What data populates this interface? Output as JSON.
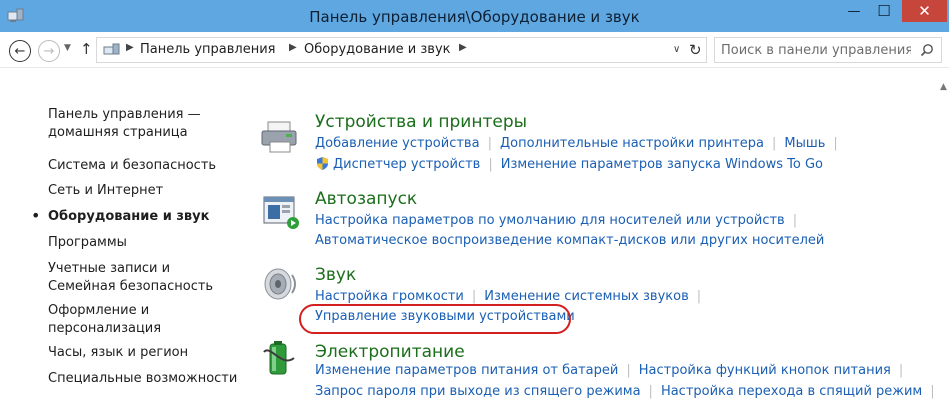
{
  "window": {
    "title": "Панель управления\\Оборудование и звук",
    "close_glyph": "✕",
    "minimize_glyph": "—",
    "maximize_glyph": "☐"
  },
  "address": {
    "crumbs": [
      "Панель управления",
      "Оборудование и звук"
    ]
  },
  "search": {
    "placeholder": "Поиск в панели управления"
  },
  "sidebar": {
    "items": [
      {
        "label": "Панель управления —\nдомашняя страница"
      },
      {
        "label": "Система и безопасность"
      },
      {
        "label": "Сеть и Интернет"
      },
      {
        "label": "Оборудование и звук",
        "active": true
      },
      {
        "label": "Программы"
      },
      {
        "label": "Учетные записи и Семейная безопасность"
      },
      {
        "label": "Оформление и персонализация"
      },
      {
        "label": "Часы, язык и регион"
      },
      {
        "label": "Специальные возможности"
      }
    ]
  },
  "categories": [
    {
      "title": "Устройства и принтеры",
      "icon": "printer-icon",
      "rows": [
        [
          "Добавление устройства",
          "Дополнительные настройки принтера",
          "Мышь"
        ],
        [
          "Диспетчер устройств",
          "Изменение параметров запуска Windows To Go"
        ]
      ]
    },
    {
      "title": "Автозапуск",
      "icon": "autoplay-icon",
      "rows": [
        [
          "Настройка параметров по умолчанию для носителей или устройств"
        ],
        [
          "Автоматическое воспроизведение компакт-дисков или других носителей"
        ]
      ]
    },
    {
      "title": "Звук",
      "icon": "speaker-icon",
      "rows": [
        [
          "Настройка громкости",
          "Изменение системных звуков"
        ],
        [
          "Управление звуковыми устройствами"
        ]
      ]
    },
    {
      "title": "Электропитание",
      "icon": "battery-icon",
      "rows": [
        [
          "Изменение параметров питания от батарей",
          "Настройка функций кнопок питания"
        ],
        [
          "Запрос пароля при выходе из спящего режима",
          "Настройка перехода в спящий режим"
        ]
      ]
    }
  ],
  "colors": {
    "titlebar": "#5fa7e0",
    "close_button": "#c7463c",
    "link": "#1a5fb4",
    "category_title": "#1b6e1b",
    "highlight_ring": "#d21f1f"
  }
}
